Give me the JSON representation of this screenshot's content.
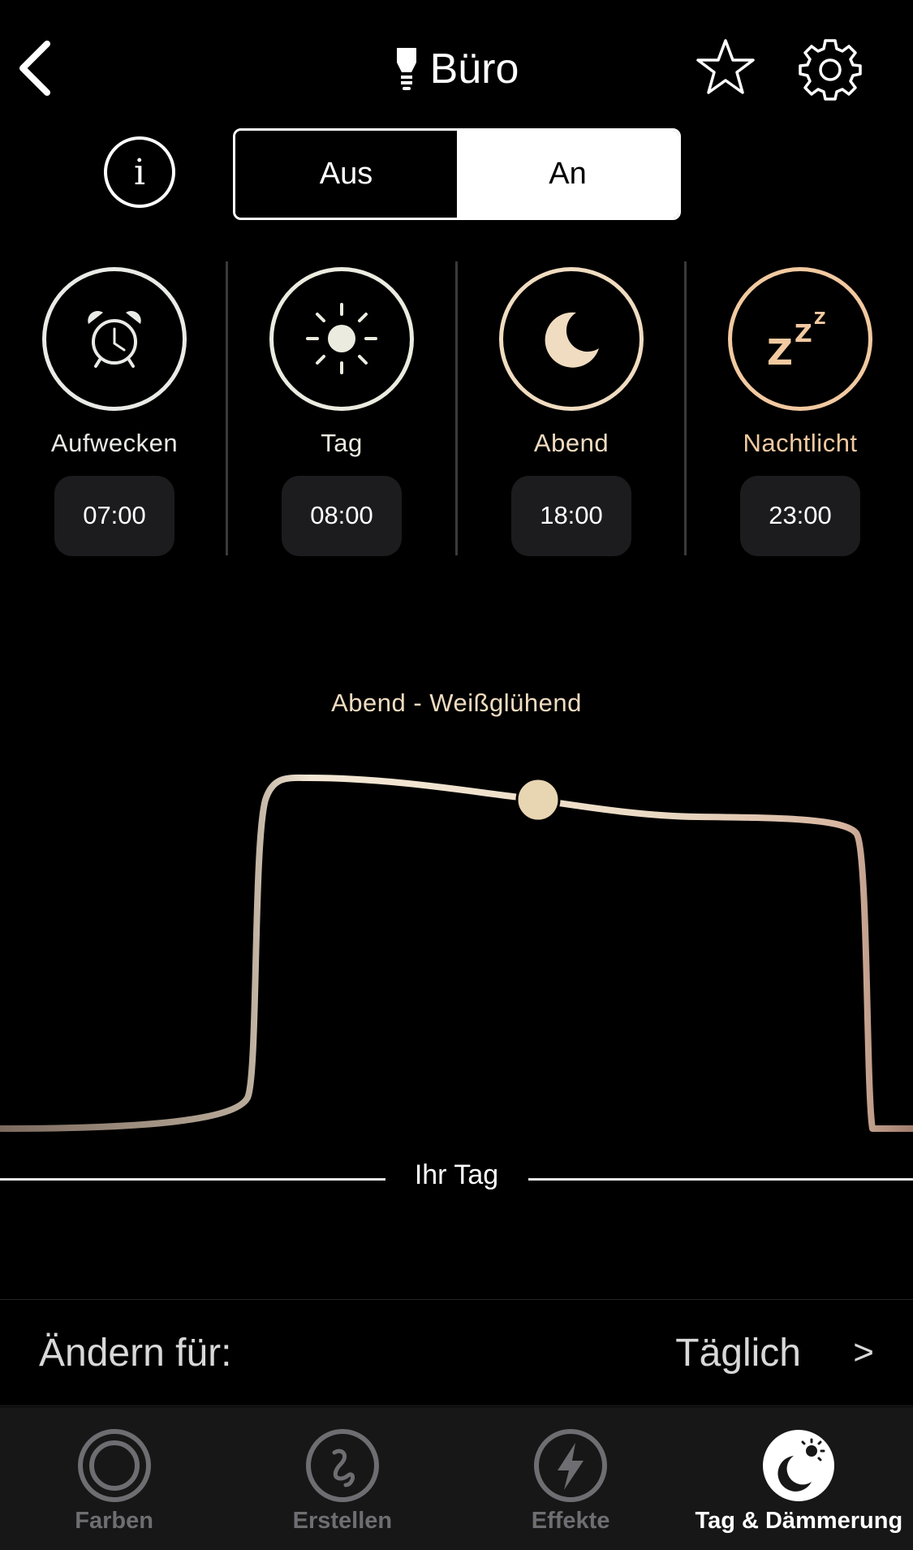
{
  "header": {
    "title": "Büro",
    "icons": {
      "back": "chevron-left-icon",
      "bulb": "lightbulb-icon",
      "favorite": "star-icon",
      "settings": "gear-icon"
    }
  },
  "power": {
    "info_glyph": "i",
    "off_label": "Aus",
    "on_label": "An",
    "selected": "An"
  },
  "scenes": [
    {
      "label": "Aufwecken",
      "time": "07:00",
      "icon": "alarm-clock-icon",
      "color": "#e9ebe6"
    },
    {
      "label": "Tag",
      "time": "08:00",
      "icon": "sun-icon",
      "color": "#ebebe0"
    },
    {
      "label": "Abend",
      "time": "18:00",
      "icon": "moon-icon",
      "color": "#f0dcc0"
    },
    {
      "label": "Nachtlicht",
      "time": "23:00",
      "icon": "sleep-zzz-icon",
      "color": "#f2c9a0"
    }
  ],
  "curve": {
    "current_label": "Abend - Weißglühend",
    "axis_label": "Ihr Tag"
  },
  "schedule": {
    "label": "Ändern für:",
    "value": "Täglich",
    "arrow": ">"
  },
  "tabs": [
    {
      "label": "Farben",
      "icon": "rings-icon",
      "active": false
    },
    {
      "label": "Erstellen",
      "icon": "squiggle-icon",
      "active": false
    },
    {
      "label": "Effekte",
      "icon": "lightning-icon",
      "active": false
    },
    {
      "label": "Tag & Dämmerung",
      "icon": "moon-sun-icon",
      "active": true
    }
  ],
  "colors": {
    "background": "#000000",
    "accent_warm": "#f0dcc0",
    "tab_inactive": "#6e6e72",
    "tab_bar": "#171717"
  }
}
